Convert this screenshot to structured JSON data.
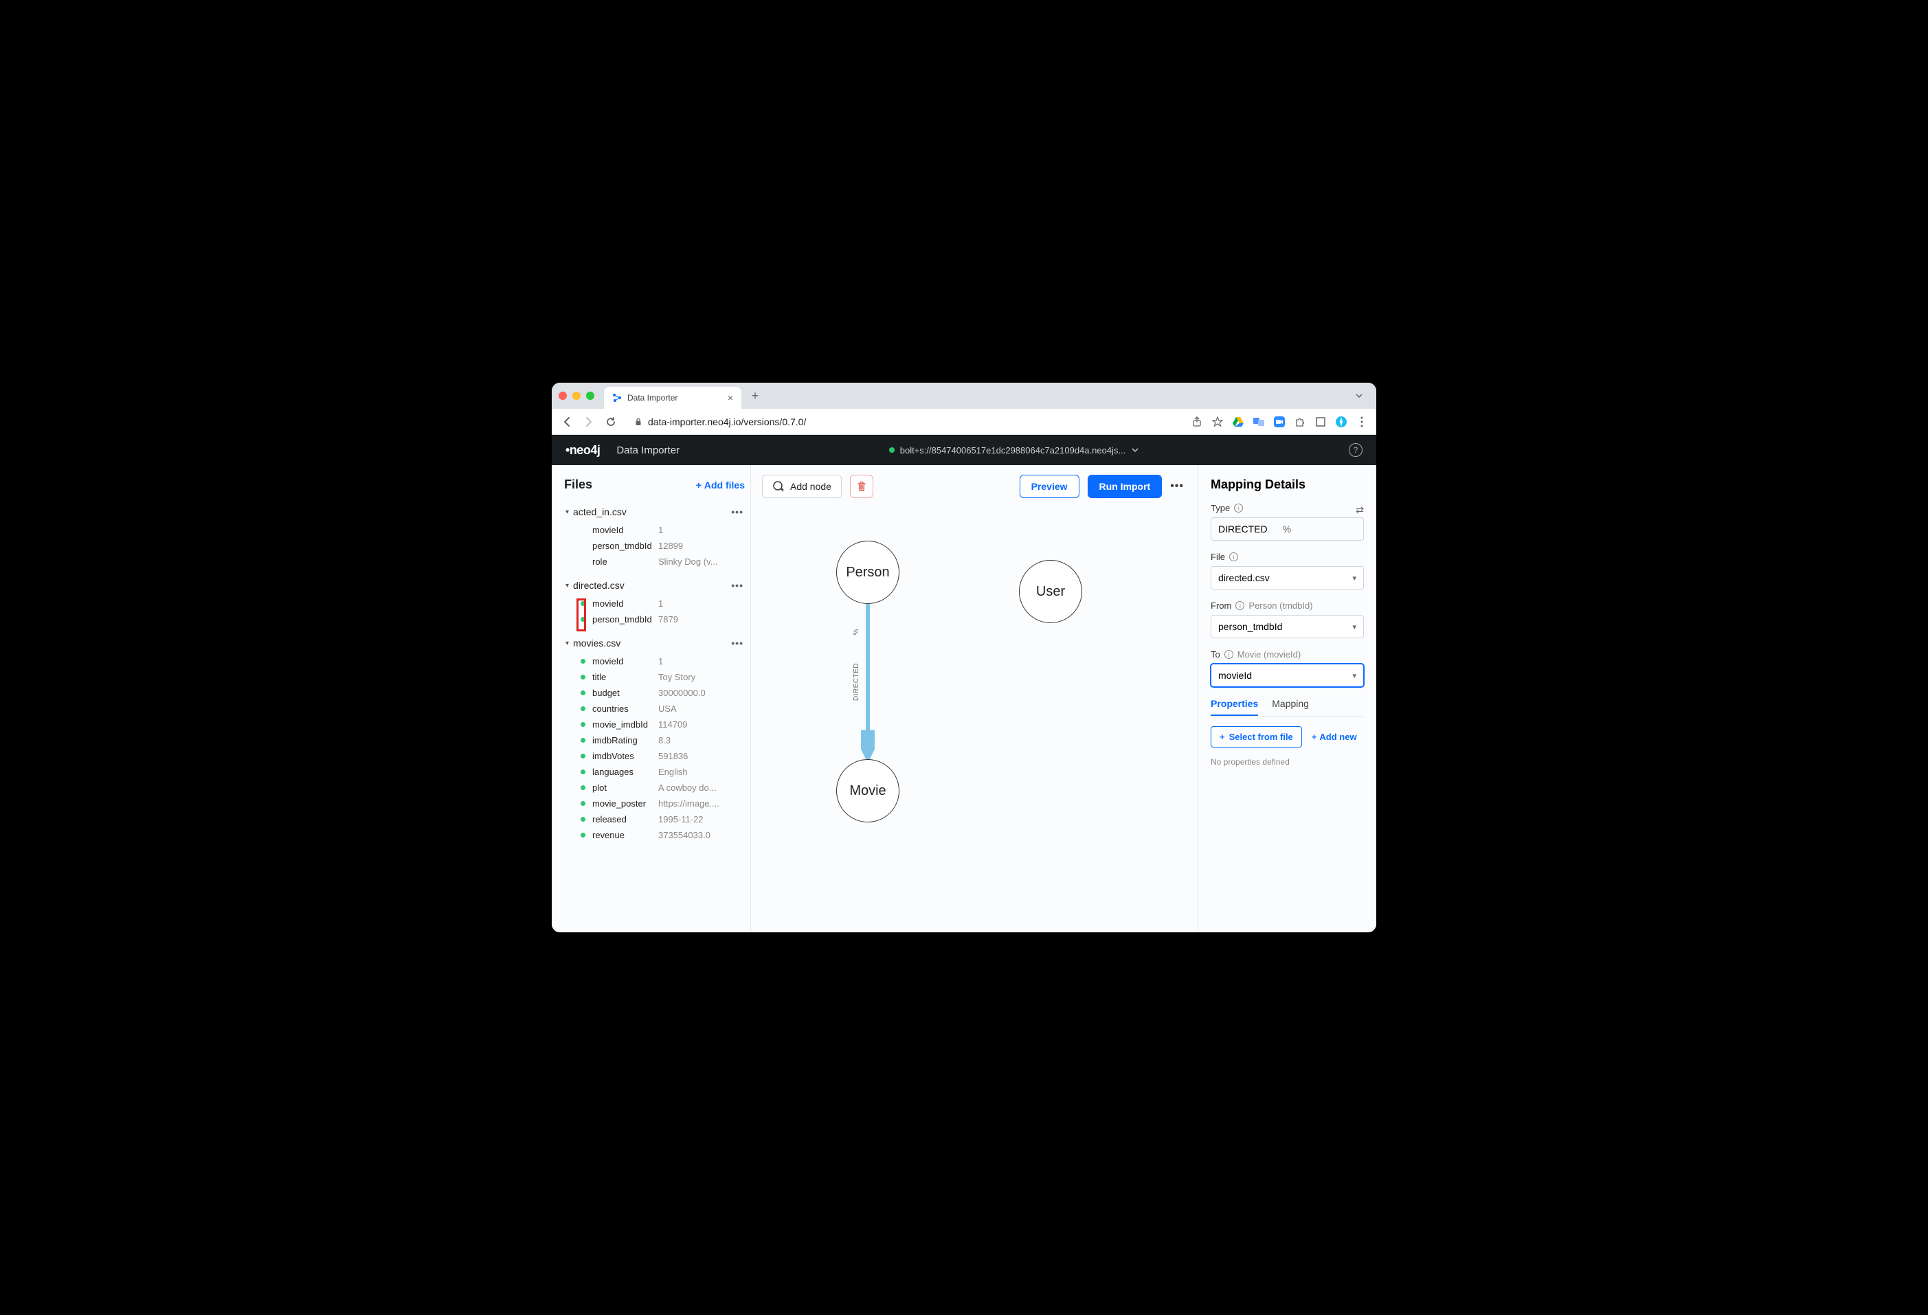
{
  "browser": {
    "tab_title": "Data Importer",
    "url": "data-importer.neo4j.io/versions/0.7.0/"
  },
  "header": {
    "logo": "neo4j",
    "app_title": "Data Importer",
    "connection": "bolt+s://85474006517e1dc2988064c7a2109d4a.neo4js..."
  },
  "canvas": {
    "preview_label": "Preview",
    "run_import_label": "Run Import",
    "add_node_label": "Add node",
    "nodes": {
      "person": "Person",
      "movie": "Movie",
      "user": "User"
    },
    "edge": {
      "label": "DIRECTED",
      "pct": "%"
    }
  },
  "files": {
    "title": "Files",
    "add_files_label": "Add files",
    "groups": [
      {
        "name": "acted_in.csv",
        "fields": [
          {
            "key": "movieId",
            "val": "1",
            "linked": false
          },
          {
            "key": "person_tmdbId",
            "val": "12899",
            "linked": false
          },
          {
            "key": "role",
            "val": "Slinky Dog (v...",
            "linked": false
          }
        ]
      },
      {
        "name": "directed.csv",
        "highlight": true,
        "fields": [
          {
            "key": "movieId",
            "val": "1",
            "linked": true
          },
          {
            "key": "person_tmdbId",
            "val": "7879",
            "linked": true
          }
        ]
      },
      {
        "name": "movies.csv",
        "fields": [
          {
            "key": "movieId",
            "val": "1",
            "linked": true
          },
          {
            "key": "title",
            "val": "Toy Story",
            "linked": true
          },
          {
            "key": "budget",
            "val": "30000000.0",
            "linked": true
          },
          {
            "key": "countries",
            "val": "USA",
            "linked": true
          },
          {
            "key": "movie_imdbId",
            "val": "114709",
            "linked": true
          },
          {
            "key": "imdbRating",
            "val": "8.3",
            "linked": true
          },
          {
            "key": "imdbVotes",
            "val": "591836",
            "linked": true
          },
          {
            "key": "languages",
            "val": "English",
            "linked": true
          },
          {
            "key": "plot",
            "val": "A cowboy do...",
            "linked": true
          },
          {
            "key": "movie_poster",
            "val": "https://image....",
            "linked": true
          },
          {
            "key": "released",
            "val": "1995-11-22",
            "linked": true
          },
          {
            "key": "revenue",
            "val": "373554033.0",
            "linked": true
          }
        ]
      }
    ]
  },
  "mapping": {
    "title": "Mapping Details",
    "type_label": "Type",
    "type_value": "DIRECTED",
    "type_pct": "%",
    "file_label": "File",
    "file_value": "directed.csv",
    "from_label": "From",
    "from_hint": "Person (tmdbId)",
    "from_value": "person_tmdbId",
    "to_label": "To",
    "to_hint": "Movie (movieId)",
    "to_value": "movieId",
    "tab_properties": "Properties",
    "tab_mapping": "Mapping",
    "select_from_file": "Select from file",
    "add_new": "Add new",
    "no_props": "No properties defined"
  }
}
